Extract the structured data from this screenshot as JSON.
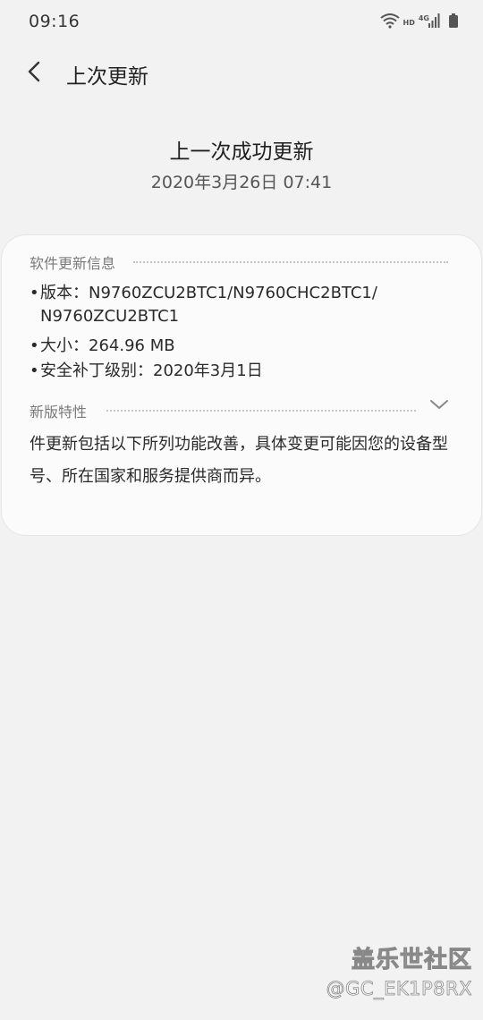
{
  "status_bar": {
    "time": "09:16",
    "hd": "HD",
    "network": "4G",
    "icons": [
      "wifi-icon",
      "hd-icon",
      "signal-icon",
      "battery-icon"
    ]
  },
  "app_bar": {
    "title": "上次更新",
    "back_icon": "back-arrow-icon"
  },
  "header": {
    "title": "上一次成功更新",
    "date": "2020年3月26日 07:41"
  },
  "software_info": {
    "heading": "软件更新信息",
    "bullet": "•",
    "version_label": "版本：",
    "version_line1": "N9760ZCU2BTC1/N9760CHC2BTC1/",
    "version_line2": "N9760ZCU2BTC1",
    "size_label": "大小：",
    "size_value": "264.96 MB",
    "patch_label": "安全补丁级别：",
    "patch_value": "2020年3月1日"
  },
  "features": {
    "heading": "新版特性",
    "expand_icon": "chevron-down-icon",
    "text": "件更新包括以下所列功能改善，具体变更可能因您的设备型号、所在国家和服务提供商而异。"
  },
  "watermark": {
    "logo": "盖乐世社区",
    "handle": "@GC_EK1P8RX"
  },
  "colors": {
    "background": "#f2f2f2",
    "card": "#fbfbfb",
    "section_label": "#7a7a7a",
    "text": "#2a2a2a"
  }
}
